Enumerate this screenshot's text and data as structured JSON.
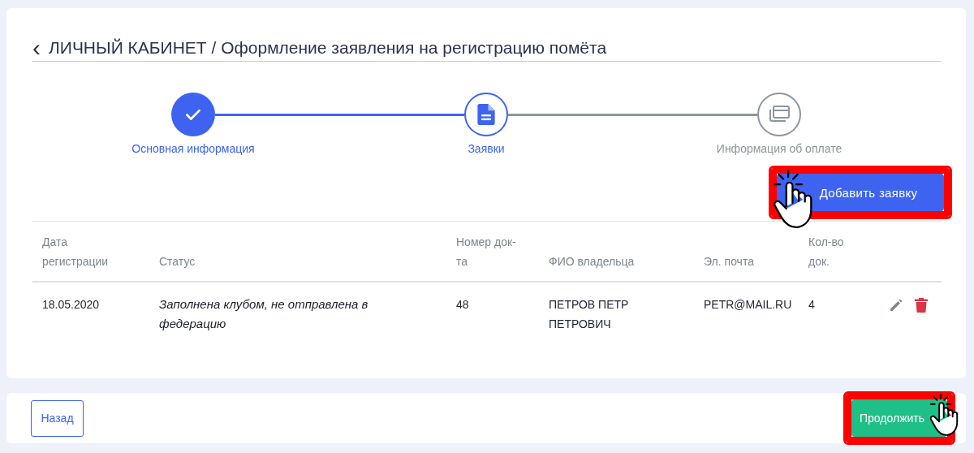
{
  "header": {
    "back_icon": "‹",
    "title": "ЛИЧНЫЙ КАБИНЕТ / Оформление заявления на регистрацию помёта"
  },
  "steps": [
    {
      "label": "Основная информация",
      "completed": true,
      "selected": false
    },
    {
      "label": "Заявки",
      "completed": false,
      "selected": true
    },
    {
      "label": "Информация об оплате",
      "completed": false,
      "selected": false
    }
  ],
  "add_button": {
    "label": "Добавить заявку",
    "highlighted": true
  },
  "table": {
    "columns": [
      "Дата регистрации",
      "Статус",
      "Номер док-та",
      "ФИО владельца",
      "Эл. почта",
      "Кол-во док."
    ],
    "rows": [
      {
        "date": "18.05.2020",
        "status": "Заполнена клубом, не отправлена в федерацию",
        "number": "48",
        "owner": "ПЕТРОВ ПЕТР ПЕТРОВИЧ",
        "email": "PETR@MAIL.RU",
        "count": "4"
      }
    ]
  },
  "footer": {
    "back_button": "Назад",
    "continue_button": {
      "label": "Продолжить",
      "highlighted": true
    }
  }
}
